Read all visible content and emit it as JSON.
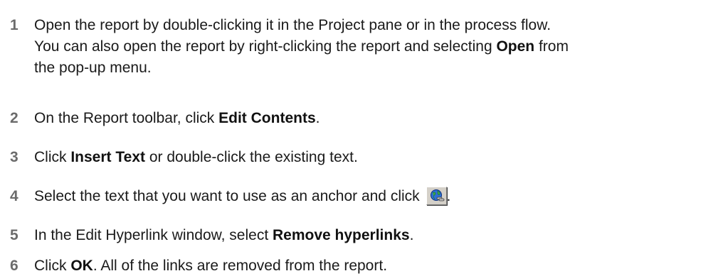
{
  "steps": [
    {
      "number": "1",
      "lines": [
        [
          "Open the report by double-clicking it in the Project pane or in the process flow."
        ],
        [
          "You can also open the report by right-clicking the report and selecting ",
          {
            "bold": "Open"
          },
          " from"
        ],
        [
          "the pop-up menu."
        ]
      ]
    },
    {
      "number": "2",
      "lines": [
        [
          "On the Report toolbar, click ",
          {
            "bold": "Edit Contents"
          },
          "."
        ]
      ]
    },
    {
      "number": "3",
      "lines": [
        [
          "Click ",
          {
            "bold": "Insert Text"
          },
          " or double-click the existing text."
        ]
      ]
    },
    {
      "number": "4",
      "lines": [
        [
          "Select the text that you want to use as an anchor and click ",
          {
            "icon": "hyperlink-globe-icon"
          },
          "."
        ]
      ]
    },
    {
      "number": "5",
      "lines": [
        [
          "In the Edit Hyperlink window, select ",
          {
            "bold": "Remove hyperlinks"
          },
          "."
        ]
      ]
    },
    {
      "number": "6",
      "lines": [
        [
          "Click ",
          {
            "bold": "OK"
          },
          ". All of the links are removed from the report."
        ]
      ]
    }
  ]
}
